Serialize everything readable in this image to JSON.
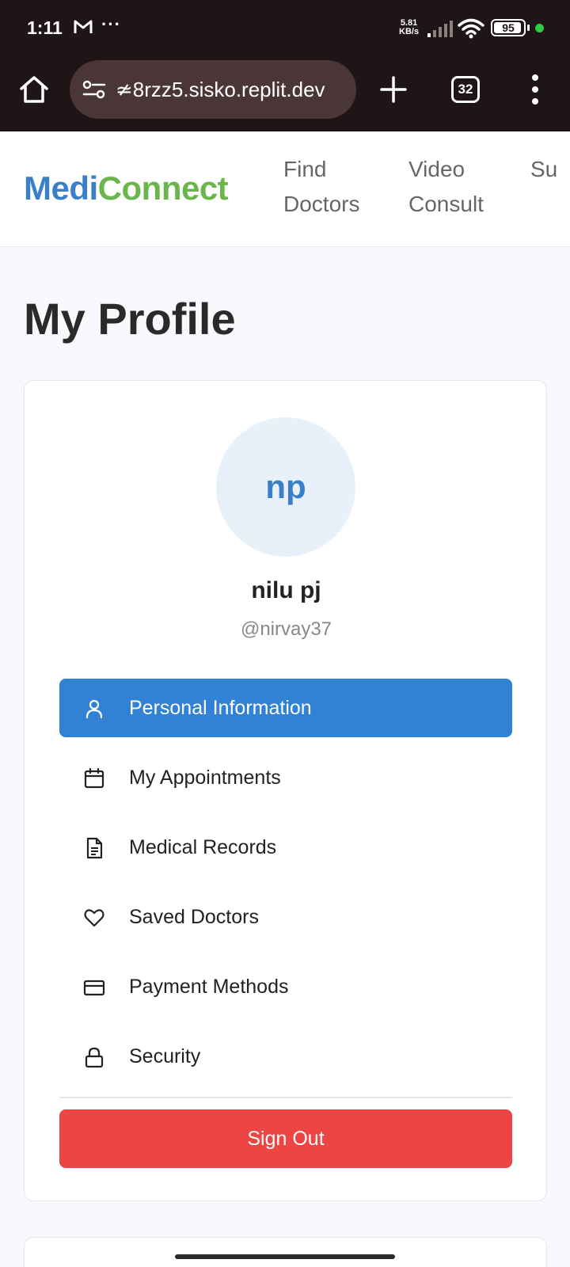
{
  "status_bar": {
    "time": "1:11",
    "more": "···",
    "net_speed_value": "5.81",
    "net_speed_unit": "KB/s",
    "battery_level": 95,
    "battery_text": "95"
  },
  "browser": {
    "url": "≄8rzz5.sisko.replit.dev",
    "tab_count": "32"
  },
  "header": {
    "logo_part1": "Medi",
    "logo_part2": "Connect",
    "logo_color1": "#3a7fc8",
    "logo_color2": "#6ab64c",
    "nav": [
      {
        "label": "Find\nDoctors"
      },
      {
        "label": "Video\nConsult"
      },
      {
        "label": "Su"
      }
    ]
  },
  "page": {
    "title": "My Profile"
  },
  "profile": {
    "initials": "np",
    "name": "nilu pj",
    "handle": "@nirvay37"
  },
  "menu": {
    "items": [
      {
        "label": "Personal Information",
        "icon": "user-icon",
        "active": true
      },
      {
        "label": "My Appointments",
        "icon": "calendar-icon",
        "active": false
      },
      {
        "label": "Medical Records",
        "icon": "document-icon",
        "active": false
      },
      {
        "label": "Saved Doctors",
        "icon": "heart-icon",
        "active": false
      },
      {
        "label": "Payment Methods",
        "icon": "credit-card-icon",
        "active": false
      },
      {
        "label": "Security",
        "icon": "lock-icon",
        "active": false
      }
    ]
  },
  "actions": {
    "sign_out": "Sign Out",
    "sign_out_color": "#ef4444",
    "active_color": "#3182d4"
  }
}
